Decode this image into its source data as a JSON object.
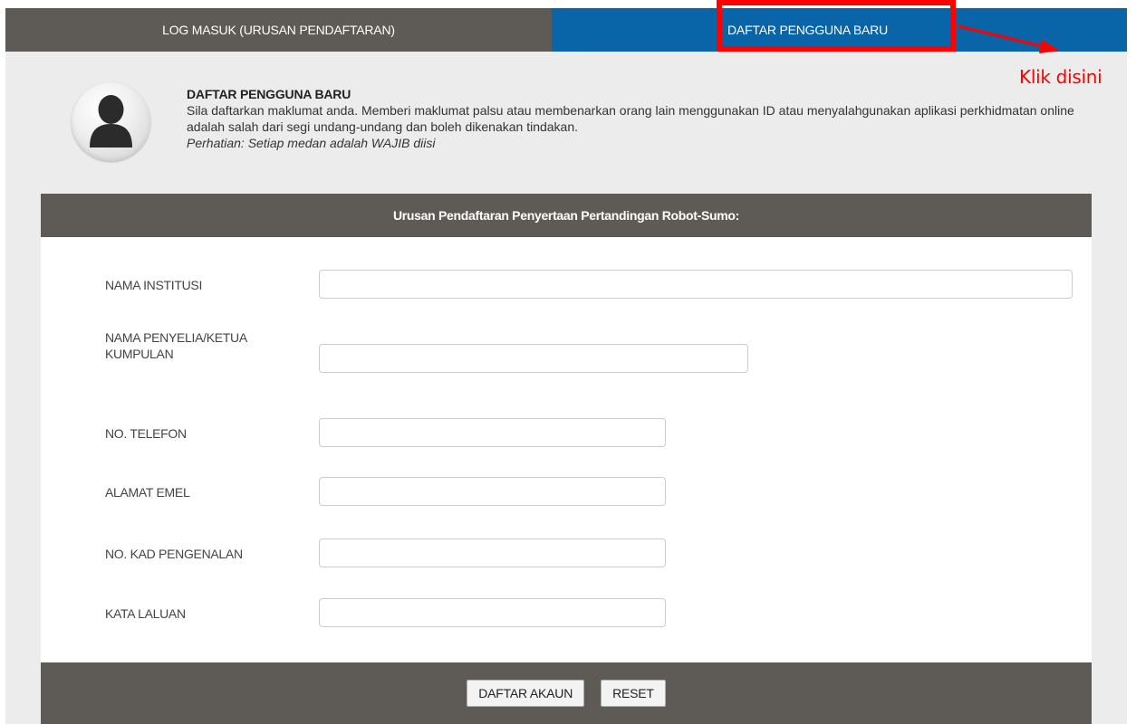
{
  "tabs": {
    "login": "LOG MASUK (URUSAN PENDAFTARAN)",
    "register": "DAFTAR PENGGUNA BARU"
  },
  "intro": {
    "title": "DAFTAR PENGGUNA BARU",
    "description": "Sila daftarkan maklumat anda. Memberi maklumat palsu atau membenarkan orang lain menggunakan ID atau menyalahgunakan aplikasi perkhidmatan online adalah salah dari segi undang-undang dan boleh dikenakan tindakan.",
    "note": "Perhatian: Setiap medan adalah WAJIB diisi",
    "avatar_icon": "user-avatar-icon"
  },
  "form": {
    "header": "Urusan Pendaftaran Penyertaan Pertandingan Robot-Sumo:",
    "fields": [
      {
        "label": "NAMA INSTITUSI",
        "value": ""
      },
      {
        "label": "NAMA PENYELIA/KETUA KUMPULAN",
        "value": ""
      },
      {
        "label": "NO. TELEFON",
        "value": ""
      },
      {
        "label": "ALAMAT EMEL",
        "value": ""
      },
      {
        "label": "NO. KAD PENGENALAN",
        "value": ""
      },
      {
        "label": "KATA LALUAN",
        "value": ""
      }
    ],
    "buttons": {
      "submit": "DAFTAR AKAUN",
      "reset": "RESET"
    }
  },
  "annotation": {
    "label": "Klik disini",
    "color": "#ff0000"
  },
  "colors": {
    "tab_dark": "#5e5a55",
    "tab_active": "#0a64a8",
    "panel_bg": "#ececec"
  }
}
